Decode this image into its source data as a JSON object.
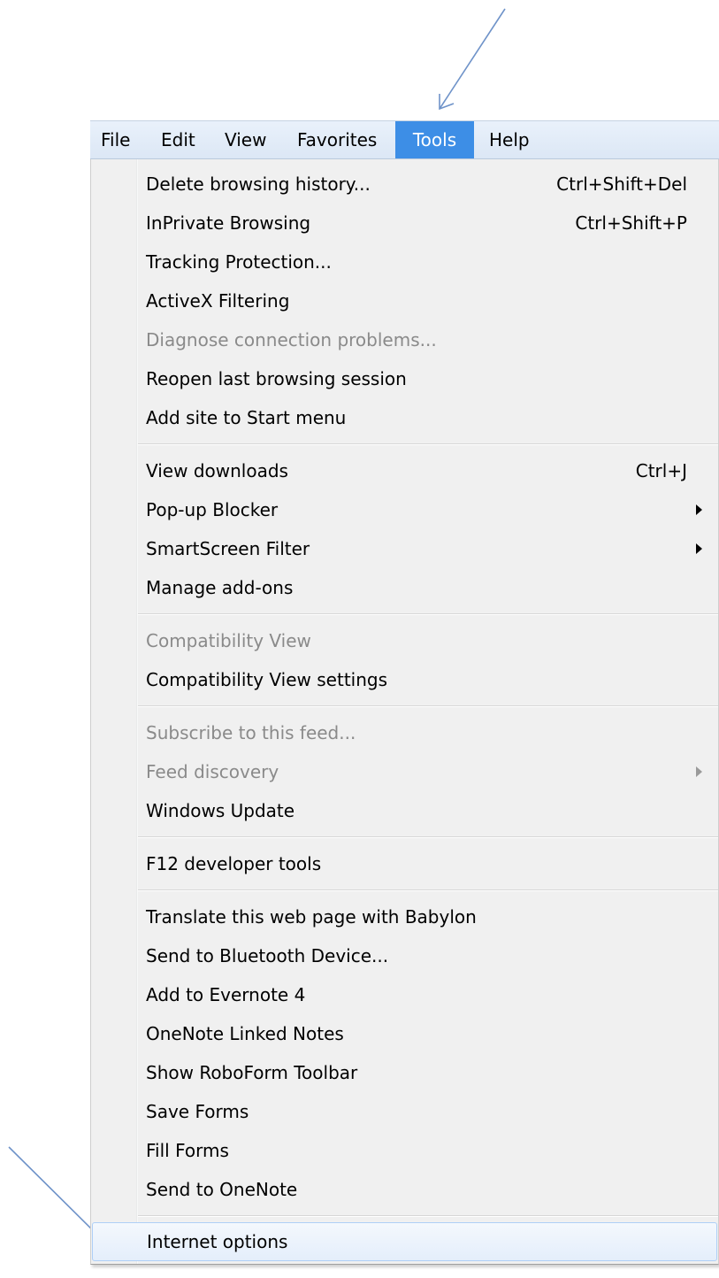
{
  "menubar": {
    "items": [
      {
        "label": "File"
      },
      {
        "label": "Edit"
      },
      {
        "label": "View"
      },
      {
        "label": "Favorites"
      },
      {
        "label": "Tools",
        "active": true
      },
      {
        "label": "Help"
      }
    ]
  },
  "tools_menu": {
    "groups": [
      {
        "items": [
          {
            "label": "Delete browsing history...",
            "shortcut": "Ctrl+Shift+Del"
          },
          {
            "label": "InPrivate Browsing",
            "shortcut": "Ctrl+Shift+P"
          },
          {
            "label": "Tracking Protection..."
          },
          {
            "label": "ActiveX Filtering"
          },
          {
            "label": "Diagnose connection problems...",
            "disabled": true
          },
          {
            "label": "Reopen last browsing session"
          },
          {
            "label": "Add site to Start menu"
          }
        ]
      },
      {
        "items": [
          {
            "label": "View downloads",
            "shortcut": "Ctrl+J"
          },
          {
            "label": "Pop-up Blocker",
            "submenu": true
          },
          {
            "label": "SmartScreen Filter",
            "submenu": true
          },
          {
            "label": "Manage add-ons"
          }
        ]
      },
      {
        "items": [
          {
            "label": "Compatibility View",
            "disabled": true
          },
          {
            "label": "Compatibility View settings"
          }
        ]
      },
      {
        "items": [
          {
            "label": "Subscribe to this feed...",
            "disabled": true
          },
          {
            "label": "Feed discovery",
            "disabled": true,
            "submenu": true
          },
          {
            "label": "Windows Update"
          }
        ]
      },
      {
        "items": [
          {
            "label": "F12 developer tools"
          }
        ]
      },
      {
        "items": [
          {
            "label": "Translate this web page with Babylon"
          },
          {
            "label": "Send to Bluetooth Device..."
          },
          {
            "label": "Add to Evernote 4"
          },
          {
            "label": "OneNote Linked Notes"
          },
          {
            "label": "Show RoboForm Toolbar"
          },
          {
            "label": "Save Forms"
          },
          {
            "label": "Fill Forms"
          },
          {
            "label": "Send to OneNote"
          }
        ]
      },
      {
        "items": [
          {
            "label": "Internet options",
            "highlighted": true
          }
        ]
      }
    ]
  },
  "colors": {
    "menubar_active": "#3d8ee6",
    "menu_background": "#f0f0f0",
    "disabled_text": "#8a8a8a",
    "callout_arrow": "#6f93c9"
  },
  "annotations": [
    {
      "icon": "callout-arrow-icon",
      "points_to": "Tools"
    },
    {
      "icon": "callout-arrow-icon",
      "points_to": "Internet options"
    }
  ]
}
